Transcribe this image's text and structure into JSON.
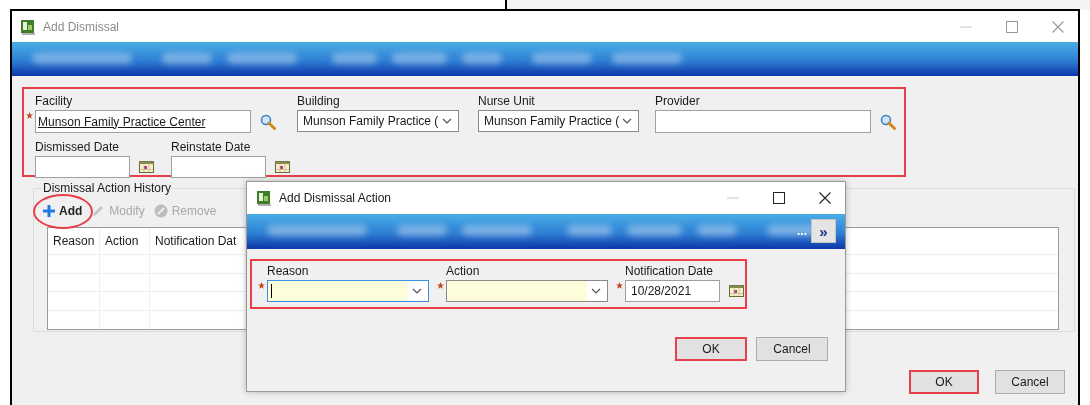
{
  "main_window": {
    "title": "Add Dismissal",
    "field_group": {
      "highlighted": true,
      "rows": [
        [
          {
            "kind": "lookup",
            "label": "Facility",
            "value": "Munson Family Practice Center",
            "required": true
          },
          {
            "kind": "combo",
            "label": "Building",
            "value": "Munson Family Practice (",
            "required": false
          },
          {
            "kind": "combo",
            "label": "Nurse Unit",
            "value": "Munson Family Practice (",
            "required": false
          },
          {
            "kind": "lookup",
            "label": "Provider",
            "required": false
          }
        ],
        [
          {
            "kind": "date",
            "label": "Dismissed Date",
            "required": false
          },
          {
            "kind": "date",
            "label": "Reinstate Date",
            "required": false
          }
        ]
      ]
    },
    "history": {
      "title": "Dismissal Action History",
      "toolbar": [
        {
          "kind": "add",
          "label": "Add",
          "disabled": false,
          "highlighted": true
        },
        {
          "kind": "modify",
          "label": "Modify",
          "disabled": true,
          "highlighted": false
        },
        {
          "kind": "remove",
          "label": "Remove",
          "disabled": true,
          "highlighted": false
        }
      ],
      "columns": [
        "Reason",
        "Action",
        "Notification Dat"
      ]
    },
    "buttons": [
      {
        "label": "OK",
        "highlighted": true
      },
      {
        "label": "Cancel",
        "highlighted": false
      }
    ]
  },
  "dialog": {
    "title": "Add Dismissal Action",
    "banner_overflow": "...",
    "banner_button": "»",
    "field_group": {
      "highlighted": true,
      "fields": [
        {
          "kind": "combo",
          "label": "Reason",
          "required": true,
          "focused": true
        },
        {
          "kind": "combo",
          "label": "Action",
          "required": true,
          "focused": false
        },
        {
          "kind": "date",
          "label": "Notification Date",
          "value": "10/28/2021",
          "required": true,
          "focused": false
        }
      ]
    },
    "buttons": [
      {
        "label": "OK",
        "highlighted": true
      },
      {
        "label": "Cancel",
        "highlighted": false
      }
    ]
  }
}
